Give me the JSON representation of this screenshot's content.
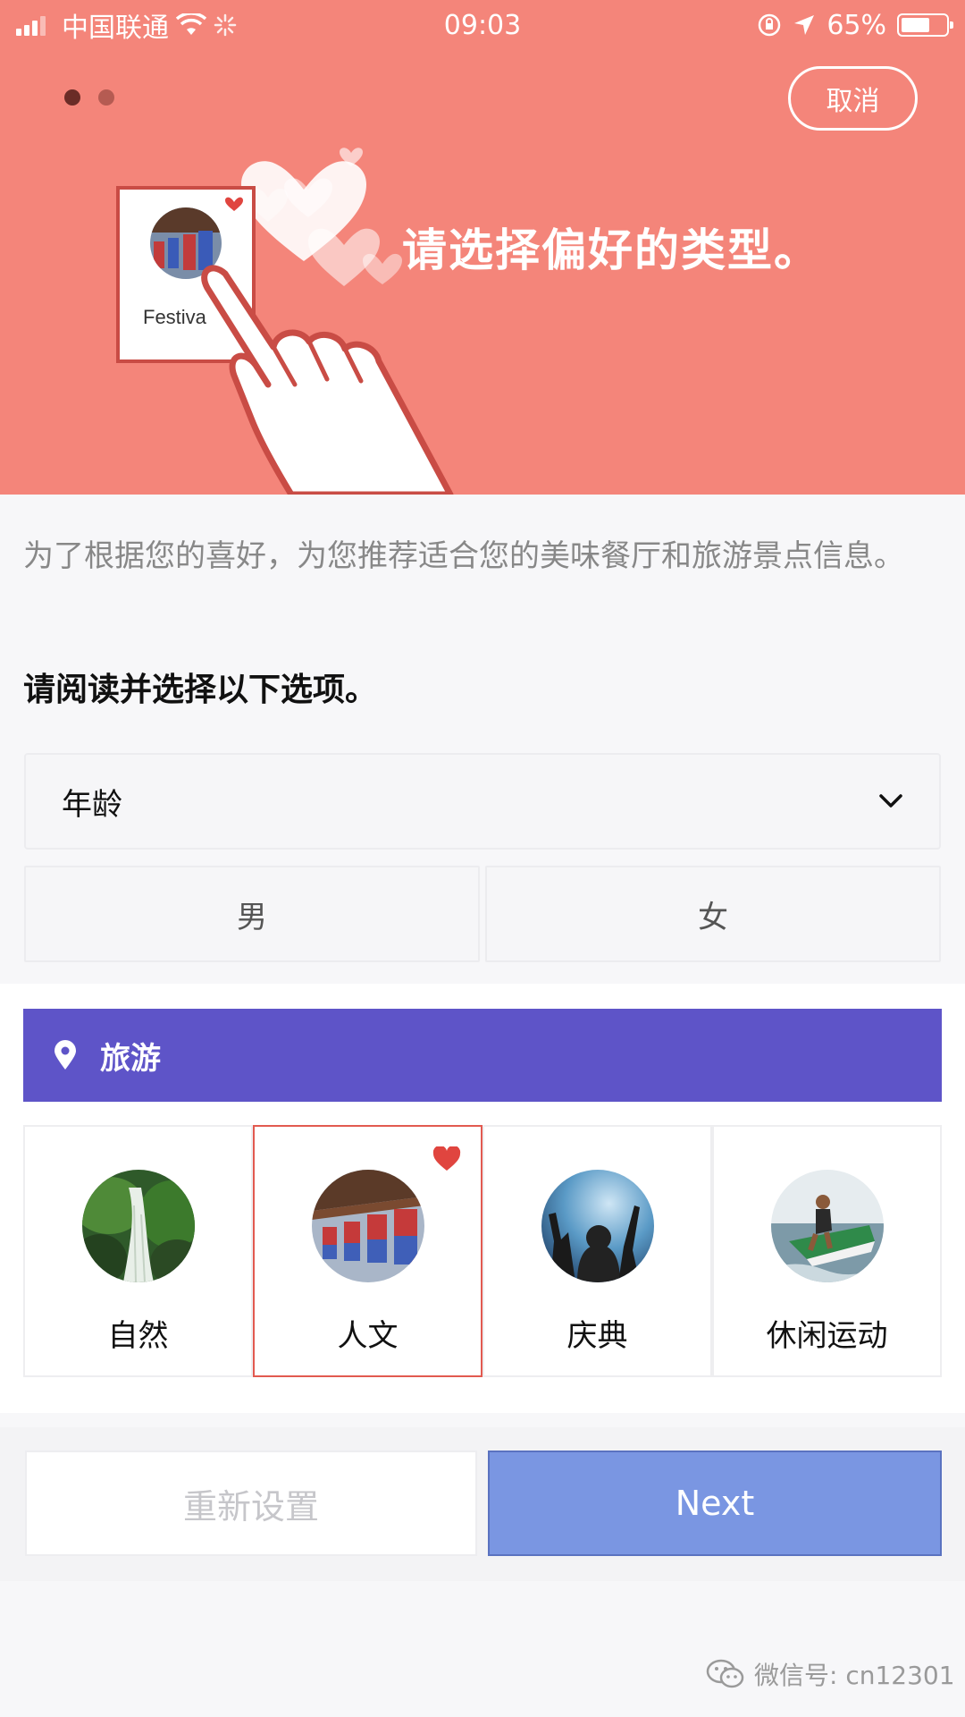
{
  "status_bar": {
    "carrier": "中国联通",
    "time": "09:03",
    "battery": "65%",
    "battery_level": 0.65
  },
  "hero": {
    "cancel_label": "取消",
    "title": "请选择偏好的类型。",
    "card_label": "Festiva",
    "page_count": 2,
    "active_page": 1,
    "background_color": "#f4857a"
  },
  "intro_text": "为了根据您的喜好，为您推荐适合您的美味餐厅和旅游景点信息。",
  "instruction": "请阅读并选择以下选项。",
  "form": {
    "age_label": "年龄",
    "gender_options": [
      "男",
      "女"
    ]
  },
  "travel": {
    "header_label": "旅游",
    "header_color": "#5e54c8",
    "categories": [
      {
        "label": "自然",
        "selected": false
      },
      {
        "label": "人文",
        "selected": true
      },
      {
        "label": "庆典",
        "selected": false
      },
      {
        "label": "休闲运动",
        "selected": false
      }
    ]
  },
  "actions": {
    "reset_label": "重新设置",
    "next_label": "Next",
    "next_color": "#7a96e2"
  },
  "watermark": "微信号: cn12301"
}
